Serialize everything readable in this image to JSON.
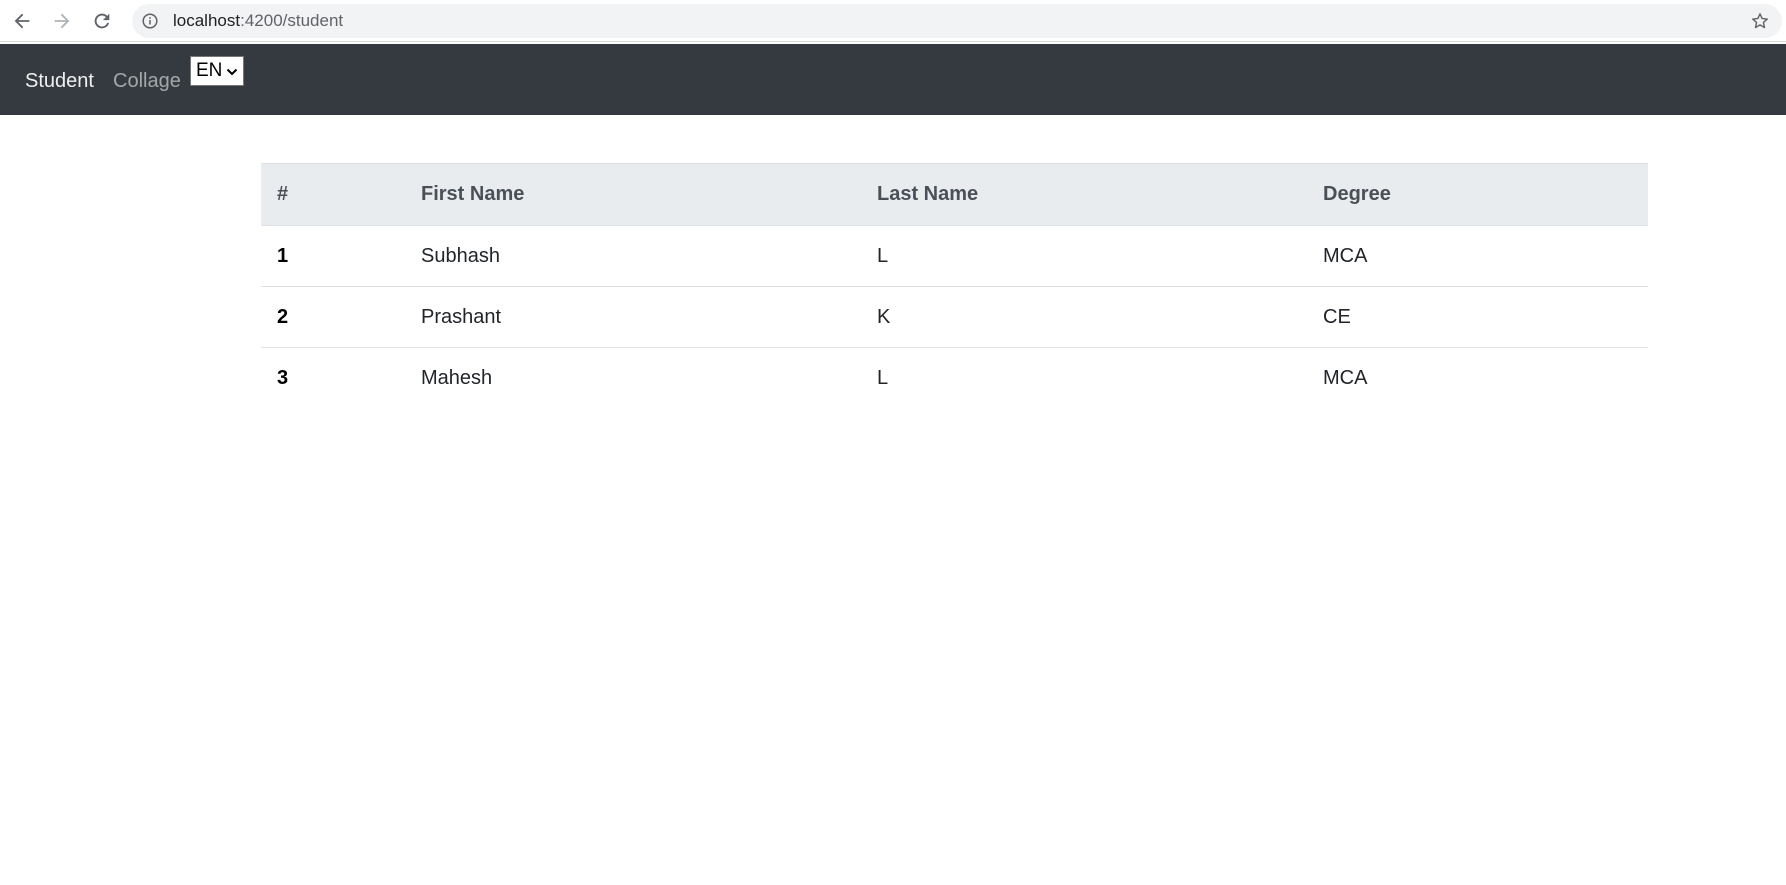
{
  "browser": {
    "url_host": "localhost",
    "url_path": ":4200/student",
    "icons": {
      "back": "arrow-left-icon",
      "forward": "arrow-right-icon",
      "reload": "reload-icon",
      "info": "info-icon",
      "bookmark": "star-icon"
    }
  },
  "navbar": {
    "links": [
      {
        "label": "Student",
        "active": true
      },
      {
        "label": "Collage",
        "active": false
      }
    ],
    "language": {
      "selected": "EN"
    },
    "background": "#343a40"
  },
  "table": {
    "headers": [
      "#",
      "First Name",
      "Last Name",
      "Degree"
    ],
    "rows": [
      {
        "num": "1",
        "first": "Subhash",
        "last": "L",
        "degree": "MCA"
      },
      {
        "num": "2",
        "first": "Prashant",
        "last": "K",
        "degree": "CE"
      },
      {
        "num": "3",
        "first": "Mahesh",
        "last": "L",
        "degree": "MCA"
      }
    ],
    "header_background": "#e9ecef"
  }
}
